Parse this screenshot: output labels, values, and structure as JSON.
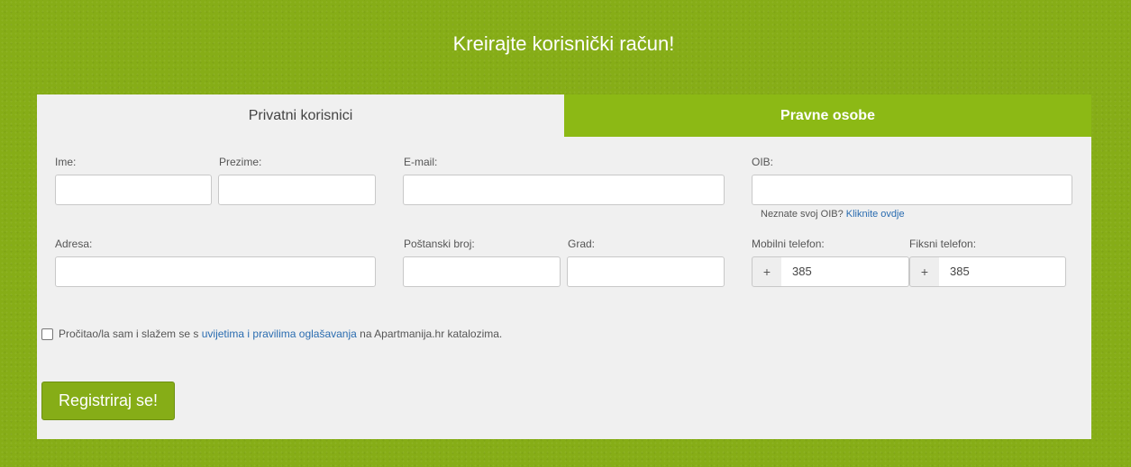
{
  "page_title": "Kreirajte korisnički račun!",
  "tabs": [
    {
      "label": "Privatni korisnici",
      "active": true
    },
    {
      "label": "Pravne osobe",
      "active": false
    }
  ],
  "form": {
    "ime": {
      "label": "Ime:",
      "value": ""
    },
    "prezime": {
      "label": "Prezime:",
      "value": ""
    },
    "email": {
      "label": "E-mail:",
      "value": ""
    },
    "oib": {
      "label": "OIB:",
      "value": "",
      "hint_text": "Neznate svoj OIB?",
      "hint_link": "Kliknite ovdje"
    },
    "adresa": {
      "label": "Adresa:",
      "value": ""
    },
    "postanski_broj": {
      "label": "Poštanski broj:",
      "value": ""
    },
    "grad": {
      "label": "Grad:",
      "value": ""
    },
    "mobilni": {
      "label": "Mobilni telefon:",
      "prefix": "+",
      "value": "385"
    },
    "fiksni": {
      "label": "Fiksni telefon:",
      "prefix": "+",
      "value": "385"
    }
  },
  "terms": {
    "checked": false,
    "before": "Pročitao/la sam i slažem se s",
    "link": "uvijetima i pravilima oglašavanja",
    "after": "na Apartmanija.hr katalozima."
  },
  "submit_label": "Registriraj se!",
  "colors": {
    "brand_green": "#86ad17",
    "tab_green": "#8cb915",
    "link_blue": "#2a6cb0"
  }
}
